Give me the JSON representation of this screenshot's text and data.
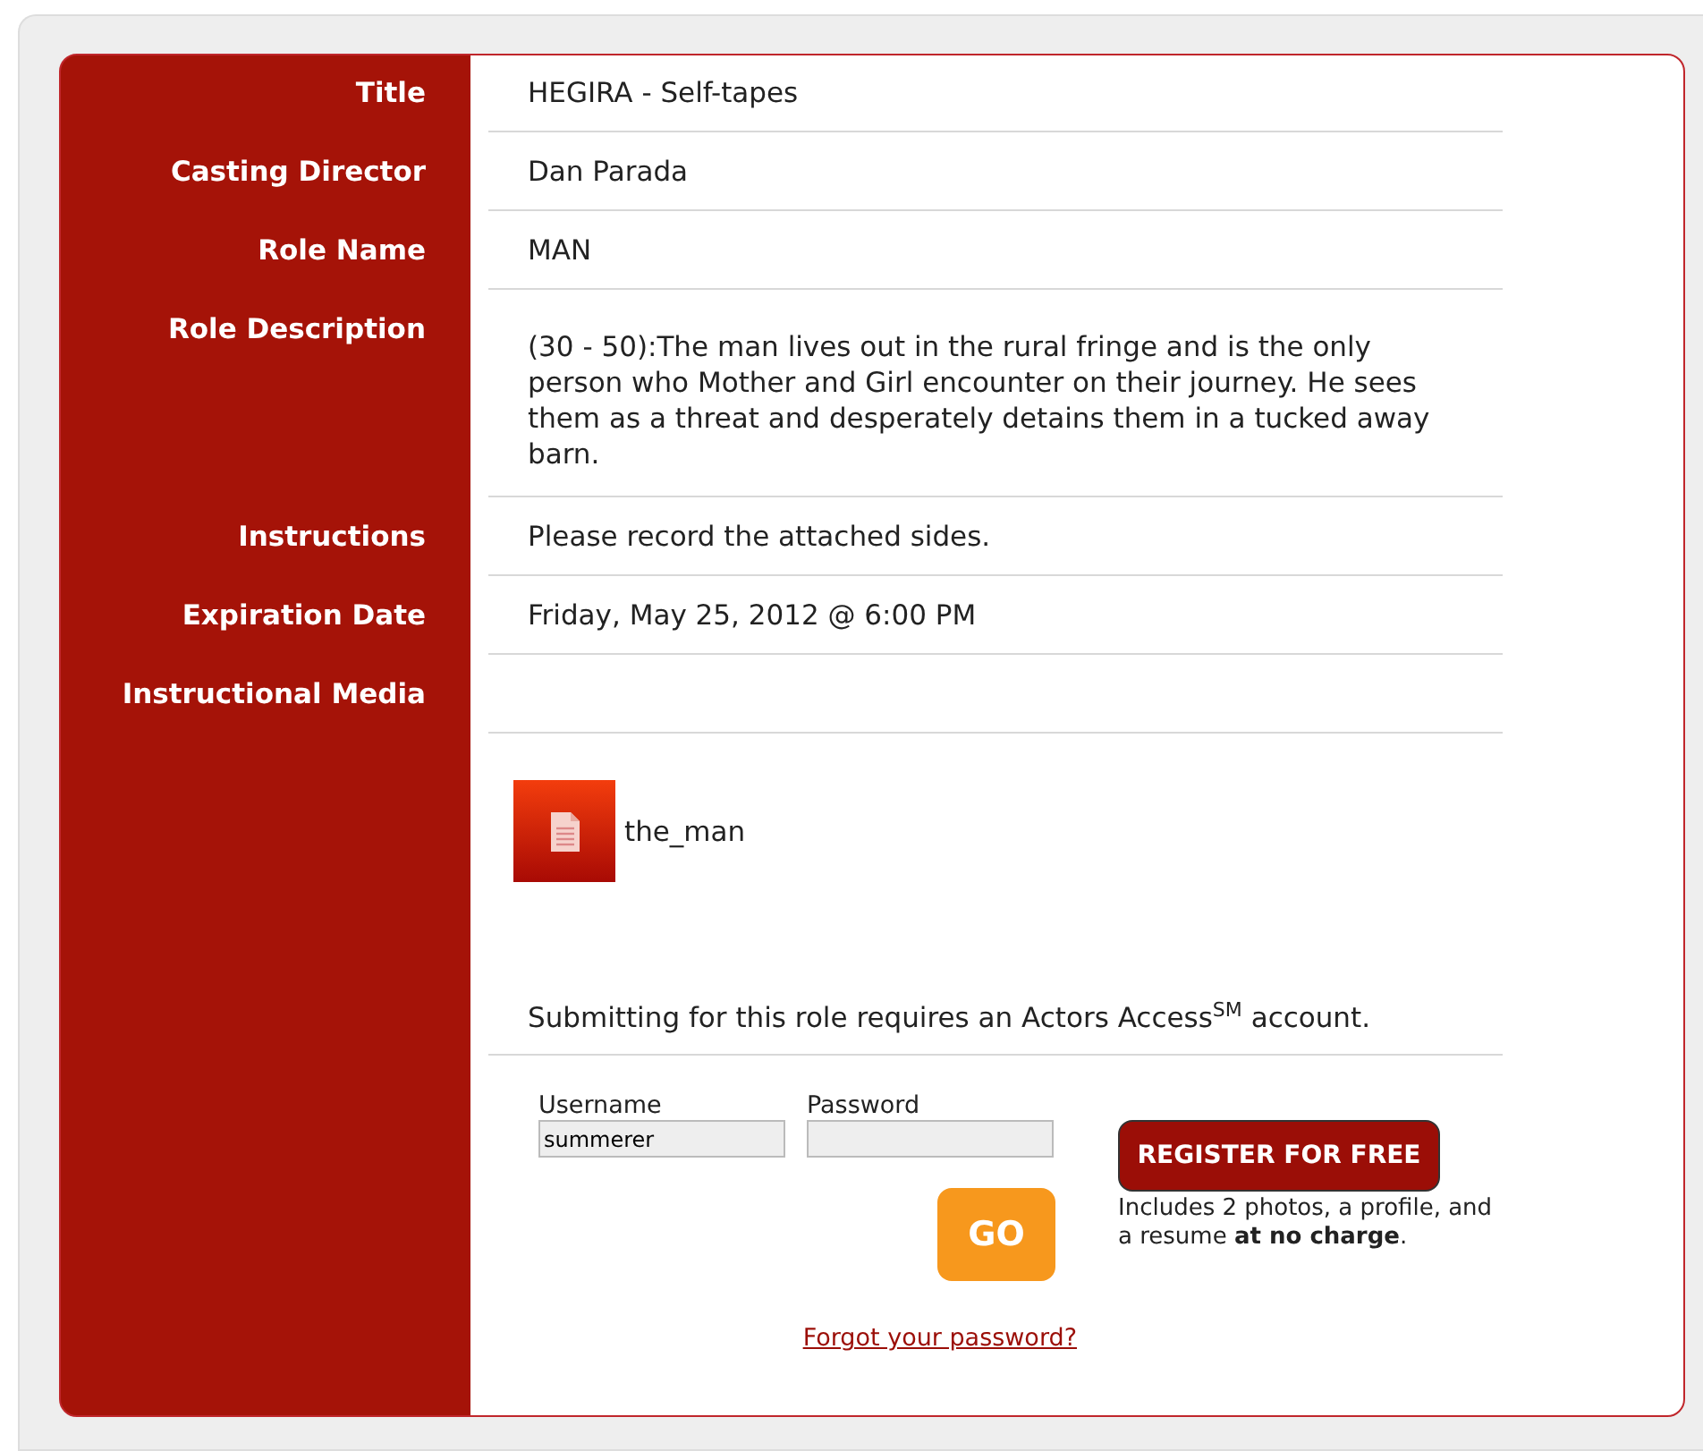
{
  "fields": [
    {
      "label": "Title",
      "value": "HEGIRA - Self-tapes"
    },
    {
      "label": "Casting Director",
      "value": "Dan Parada"
    },
    {
      "label": "Role Name",
      "value": "MAN"
    },
    {
      "label": "Role Description",
      "value": "(30 - 50):The man lives out in the rural fringe and is the only person who Mother and Girl encounter on their journey. He sees them as a threat and desperately detains them in a tucked away barn."
    },
    {
      "label": "Instructions",
      "value": "Please record the attached sides."
    },
    {
      "label": "Expiration Date",
      "value": "Friday, May 25, 2012 @ 6:00 PM"
    },
    {
      "label": "Instructional Media"
    }
  ],
  "media": [
    {
      "name": "the_man"
    }
  ],
  "notice": "Submitting for this role requires an Actors Access$^{SM}$ account.",
  "login": {
    "username_label": "Username",
    "username_value": "summerer",
    "password_label": "Password",
    "go_button": "GO",
    "register_button": "REGISTER FOR FREE",
    "register_note": "Includes 2 photos, a profile, and a resume **at no charge**.",
    "forgot_link": "Forgot your password?"
  }
}
